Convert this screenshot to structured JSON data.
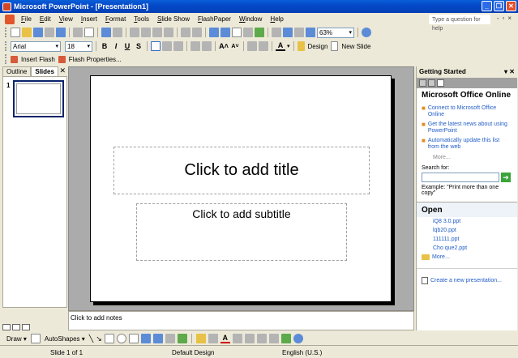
{
  "window": {
    "title": "Microsoft PowerPoint - [Presentation1]"
  },
  "menu": {
    "items": [
      "File",
      "Edit",
      "View",
      "Insert",
      "Format",
      "Tools",
      "Slide Show",
      "FlashPaper",
      "Window",
      "Help"
    ],
    "help_placeholder": "Type a question for help"
  },
  "standard_toolbar": {
    "zoom": "63%"
  },
  "formatting_toolbar": {
    "font": "Arial",
    "size": "18",
    "bold": "B",
    "italic": "I",
    "underline": "U",
    "shadow": "S",
    "design_label": "Design",
    "new_slide_label": "New Slide"
  },
  "flash_toolbar": {
    "insert_flash": "Insert Flash",
    "flash_properties": "Flash Properties..."
  },
  "left_pane": {
    "tab_outline": "Outline",
    "tab_slides": "Slides",
    "close": "✕",
    "slide_number": "1"
  },
  "slide": {
    "title_placeholder": "Click to add title",
    "subtitle_placeholder": "Click to add subtitle"
  },
  "notes": {
    "placeholder": "Click to add notes"
  },
  "task_pane": {
    "title": "Getting Started",
    "office_heading": "Microsoft Office Online",
    "links": [
      "Connect to Microsoft Office Online",
      "Get the latest news about using PowerPoint",
      "Automatically update this list from the web"
    ],
    "more": "More...",
    "search_label": "Search for:",
    "example": "Example:  \"Print more than one copy\"",
    "open_heading": "Open",
    "files": [
      "iQ8 3.0.ppt",
      "lqb20.ppt",
      "111111.ppt",
      "Cho que2.ppt"
    ],
    "files_more": "More...",
    "create": "Create a new presentation..."
  },
  "drawing_toolbar": {
    "draw": "Draw",
    "autoshapes": "AutoShapes"
  },
  "status": {
    "slide": "Slide 1 of 1",
    "design": "Default Design",
    "language": "English (U.S.)"
  }
}
